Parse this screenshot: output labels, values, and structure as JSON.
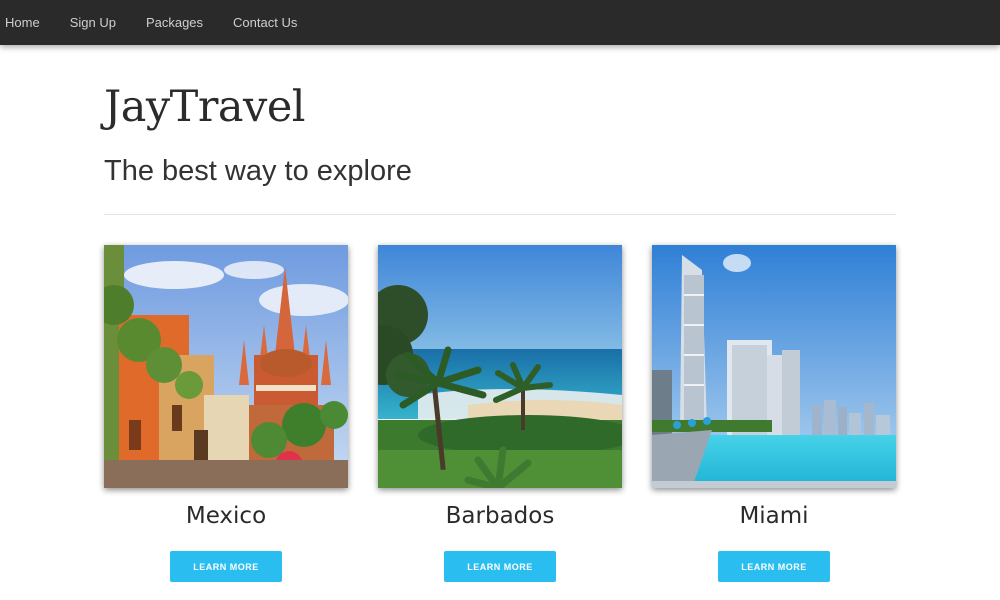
{
  "nav": {
    "items": [
      {
        "label": "Home"
      },
      {
        "label": "Sign Up"
      },
      {
        "label": "Packages"
      },
      {
        "label": "Contact Us"
      }
    ]
  },
  "hero": {
    "title": "JayTravel",
    "subtitle": "The best way to explore"
  },
  "cards": [
    {
      "title": "Mexico",
      "button": "LEARN MORE",
      "image": "colorful-colonial-street-cathedral-photo"
    },
    {
      "title": "Barbados",
      "button": "LEARN MORE",
      "image": "tropical-beach-palms-photo"
    },
    {
      "title": "Miami",
      "button": "LEARN MORE",
      "image": "rooftop-pool-city-skyline-photo"
    }
  ],
  "colors": {
    "nav_bg": "#2a2a2a",
    "button": "#29bdf0",
    "text": "#2b2b2b"
  }
}
